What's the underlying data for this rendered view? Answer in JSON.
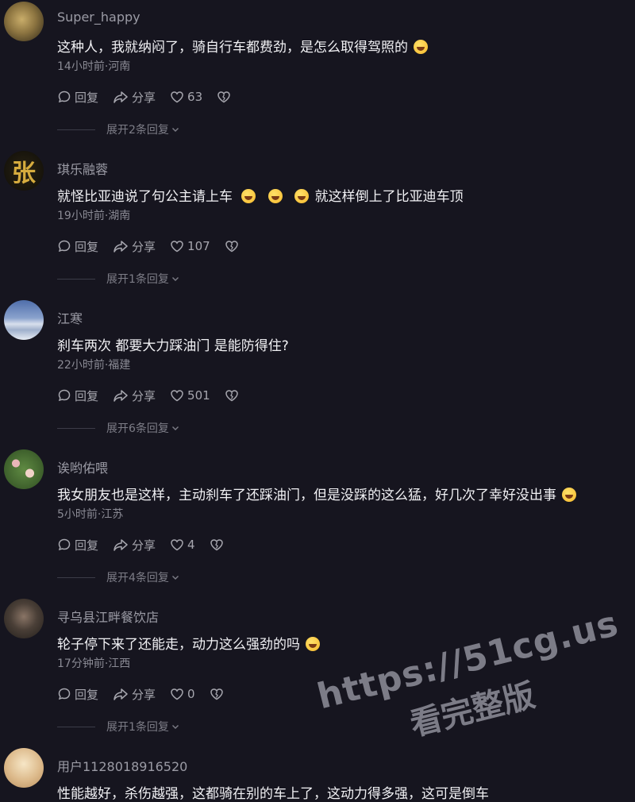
{
  "comments": [
    {
      "username": "Super_happy",
      "text": "这种人，我就纳闷了，骑自行车都费劲，是怎么取得驾照的",
      "emojis_after": 1,
      "meta": "14小时前·河南",
      "reply_label": "回复",
      "share_label": "分享",
      "likes": "63",
      "expand_label": "展开2条回复",
      "avatar_colors": [
        "#b79a55",
        "#3a3220"
      ]
    },
    {
      "username": "琪乐融蓉",
      "text": "就怪比亚迪说了句公主请上车",
      "text_after": "就这样倒上了比亚迪车顶",
      "emojis_mid": 3,
      "meta": "19小时前·湖南",
      "reply_label": "回复",
      "share_label": "分享",
      "likes": "107",
      "expand_label": "展开1条回复",
      "avatar_char": "张",
      "avatar_colors": [
        "#1d1a12",
        "#c9a13a"
      ]
    },
    {
      "username": "江寒",
      "text": "刹车两次 都要大力踩油门 是能防得住?",
      "meta": "22小时前·福建",
      "reply_label": "回复",
      "share_label": "分享",
      "likes": "501",
      "expand_label": "展开6条回复",
      "avatar_colors": [
        "#6f87b8",
        "#cfd8e8"
      ]
    },
    {
      "username": "诶哟佑喂",
      "text": "我女朋友也是这样，主动刹车了还踩油门，但是没踩的这么猛，好几次了幸好没出事",
      "emojis_after": 1,
      "meta": "5小时前·江苏",
      "reply_label": "回复",
      "share_label": "分享",
      "likes": "4",
      "expand_label": "展开4条回复",
      "avatar_colors": [
        "#4f7a3c",
        "#d7c0a8"
      ]
    },
    {
      "username": "寻乌县江畔餐饮店",
      "text": "轮子停下来了还能走，动力这么强劲的吗",
      "emojis_after": 1,
      "meta": "17分钟前·江西",
      "reply_label": "回复",
      "share_label": "分享",
      "likes": "0",
      "expand_label": "展开1条回复",
      "avatar_colors": [
        "#3a3530",
        "#8a7566"
      ]
    },
    {
      "username": "用户1128018916520",
      "text": "性能越好，杀伤越强，这都骑在别的车上了，这动力得多强，这可是倒车",
      "avatar_colors": [
        "#d9b98a",
        "#f3e2c0"
      ]
    }
  ],
  "watermark": {
    "url": "https://51cg.us",
    "caption": "看完整版"
  }
}
